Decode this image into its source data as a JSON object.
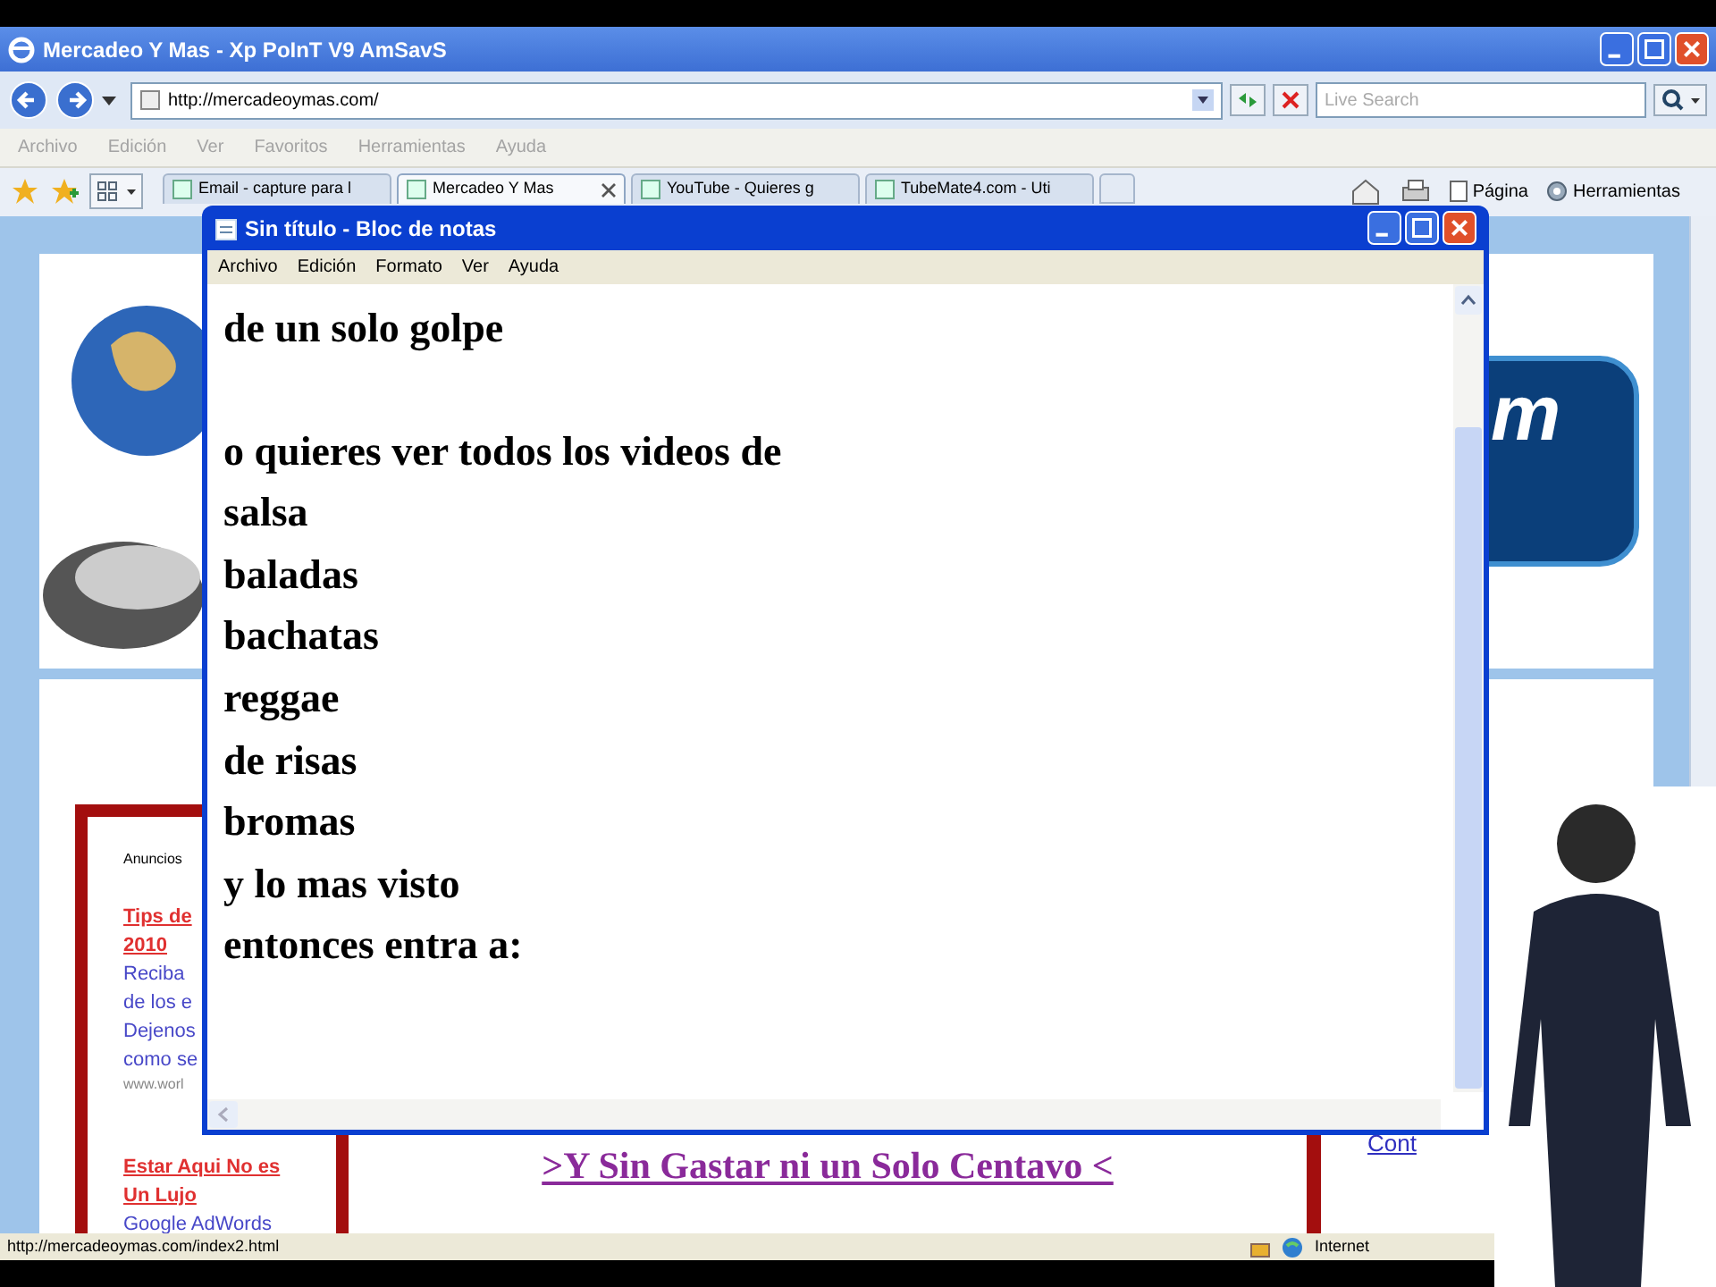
{
  "browser": {
    "title": "Mercadeo Y Mas - Xp PoInT V9 AmSavS",
    "address": "http://mercadeoymas.com/",
    "search": {
      "placeholder": "Live Search"
    },
    "menu": [
      "Archivo",
      "Edición",
      "Ver",
      "Favoritos",
      "Herramientas",
      "Ayuda"
    ],
    "tabs": [
      {
        "label": "Email - capture para l",
        "selected": false
      },
      {
        "label": "Mercadeo Y Mas",
        "selected": true
      },
      {
        "label": "YouTube - Quieres g",
        "selected": false
      },
      {
        "label": "TubeMate4.com - Uti",
        "selected": false
      }
    ],
    "toolbar": [
      "Página",
      "Herramientas"
    ],
    "status": {
      "url": "http://mercadeoymas.com/index2.html",
      "zone": "Internet"
    }
  },
  "page": {
    "logo_fragment": "m",
    "ads": {
      "header": "Anuncios",
      "items": [
        {
          "title_lines": [
            "Tips de",
            "2010"
          ],
          "text_lines": [
            "Reciba",
            "de los e",
            "Dejenos",
            "como se"
          ],
          "url": "www.worl"
        },
        {
          "title_lines": [
            "Estar Aqui No es",
            "Un Lujo"
          ],
          "text_lines": [
            "Google AdWords"
          ]
        }
      ]
    },
    "link": ">Y Sin Gastar ni un Solo Centavo <",
    "side_link": "Cont"
  },
  "notepad": {
    "title": "Sin título - Bloc de notas",
    "menu": [
      "Archivo",
      "Edición",
      "Formato",
      "Ver",
      "Ayuda"
    ],
    "paragraphs": [
      [
        "de un solo golpe"
      ],
      [
        "o quieres ver todos los videos de",
        "salsa",
        "baladas",
        "bachatas",
        "reggae",
        "de risas",
        "bromas",
        "y lo mas visto",
        "entonces entra a:"
      ]
    ]
  }
}
